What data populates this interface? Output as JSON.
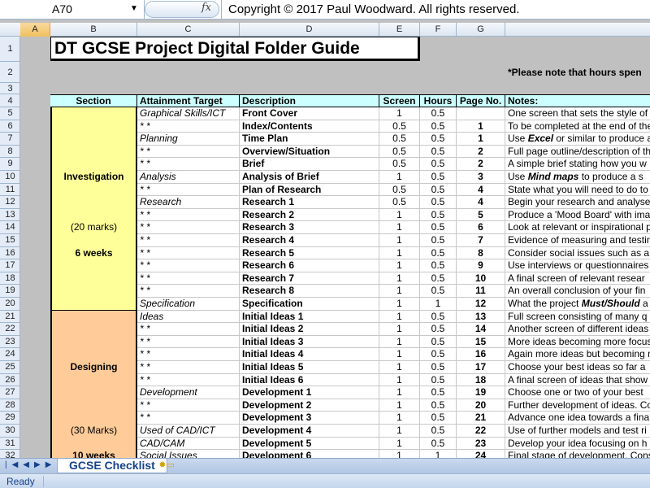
{
  "formula_bar": {
    "name_box": "A70",
    "fx_label": "fx",
    "content": "Copyright © 2017 Paul Woodward. All rights reserved."
  },
  "columns": [
    "A",
    "B",
    "C",
    "D",
    "E",
    "F",
    "G"
  ],
  "selected_column": "A",
  "title": "DT GCSE Project Digital Folder Guide",
  "hours_note": "*Please note that hours spen",
  "headers": {
    "section": "Section",
    "attainment": "Attainment Target",
    "description": "Description",
    "screen": "Screen",
    "hours": "Hours",
    "page": "Page No.",
    "notes": "Notes:"
  },
  "sections": [
    {
      "name": "Investigation",
      "marks": "(20 marks)",
      "weeks": "6 weeks",
      "color": "#ffff99"
    },
    {
      "name": "Designing",
      "marks": "(30 Marks)",
      "weeks": "10 weeks",
      "color": "#ffcc99"
    }
  ],
  "rows": [
    {
      "row": 5,
      "target": "Graphical Skills/ICT",
      "desc": "Front Cover",
      "screen": "1",
      "hours": "0.5",
      "page": "",
      "note": "One screen that sets the style of"
    },
    {
      "row": 6,
      "target": "*               *",
      "desc": "Index/Contents",
      "screen": "0.5",
      "hours": "0.5",
      "page": "1",
      "note": "To be completed at the end of the"
    },
    {
      "row": 7,
      "target": "Planning",
      "desc": "Time Plan",
      "screen": "0.5",
      "hours": "0.5",
      "page": "1",
      "note": "Use Excel  or similar to produce a"
    },
    {
      "row": 8,
      "target": "*       *",
      "desc": "Overview/Situation",
      "screen": "0.5",
      "hours": "0.5",
      "page": "2",
      "note": "Full page outline/description of th"
    },
    {
      "row": 9,
      "target": "*       *",
      "desc": "Brief",
      "screen": "0.5",
      "hours": "0.5",
      "page": "2",
      "note": "A simple brief stating how you w"
    },
    {
      "row": 10,
      "target": "Analysis",
      "desc": "Analysis of Brief",
      "screen": "1",
      "hours": "0.5",
      "page": "3",
      "note": "Use Mind maps  to produce a s"
    },
    {
      "row": 11,
      "target": "*       *",
      "desc": "Plan of Research",
      "screen": "0.5",
      "hours": "0.5",
      "page": "4",
      "note": "State what you will need to do to"
    },
    {
      "row": 12,
      "target": "Research",
      "desc": "Research 1",
      "screen": "0.5",
      "hours": "0.5",
      "page": "4",
      "note": "Begin your research and analyse"
    },
    {
      "row": 13,
      "target": "*       *",
      "desc": "Research 2",
      "screen": "1",
      "hours": "0.5",
      "page": "5",
      "note": "Produce a 'Mood Board' with ima"
    },
    {
      "row": 14,
      "target": "*       *",
      "desc": "Research 3",
      "screen": "1",
      "hours": "0.5",
      "page": "6",
      "note": "Look at relevant or inspirational p"
    },
    {
      "row": 15,
      "target": "*       *",
      "desc": "Research 4",
      "screen": "1",
      "hours": "0.5",
      "page": "7",
      "note": "Evidence of measuring and testin"
    },
    {
      "row": 16,
      "target": "*       *",
      "desc": "Research 5",
      "screen": "1",
      "hours": "0.5",
      "page": "8",
      "note": "Consider social issues such as a"
    },
    {
      "row": 17,
      "target": "*       *",
      "desc": "Research 6",
      "screen": "1",
      "hours": "0.5",
      "page": "9",
      "note": "Use interviews or questionnaires"
    },
    {
      "row": 18,
      "target": "*       *",
      "desc": "Research 7",
      "screen": "1",
      "hours": "0.5",
      "page": "10",
      "note": "A final screen of relevant resear"
    },
    {
      "row": 19,
      "target": "*       *",
      "desc": "Research 8",
      "screen": "1",
      "hours": "0.5",
      "page": "11",
      "note": "An overall conclusion of your fin"
    },
    {
      "row": 20,
      "target": "Specification",
      "desc": "Specification",
      "screen": "1",
      "hours": "1",
      "page": "12",
      "note": "What the project Must/Should  a"
    },
    {
      "row": 21,
      "target": "Ideas",
      "desc": "Initial Ideas 1",
      "screen": "1",
      "hours": "0.5",
      "page": "13",
      "note": "Full screen consisting of many q"
    },
    {
      "row": 22,
      "target": "*   *",
      "desc": "Initial Ideas 2",
      "screen": "1",
      "hours": "0.5",
      "page": "14",
      "note": "Another screen of different ideas"
    },
    {
      "row": 23,
      "target": "*   *",
      "desc": "Initial Ideas 3",
      "screen": "1",
      "hours": "0.5",
      "page": "15",
      "note": "More ideas becoming more focus"
    },
    {
      "row": 24,
      "target": "*   *",
      "desc": "Initial Ideas 4",
      "screen": "1",
      "hours": "0.5",
      "page": "16",
      "note": "Again more ideas but becoming m"
    },
    {
      "row": 25,
      "target": "*   *",
      "desc": "Initial Ideas 5",
      "screen": "1",
      "hours": "0.5",
      "page": "17",
      "note": "Choose your best ideas so far a"
    },
    {
      "row": 26,
      "target": "*   *",
      "desc": "Initial Ideas 6",
      "screen": "1",
      "hours": "0.5",
      "page": "18",
      "note": "A final screen of ideas that show"
    },
    {
      "row": 27,
      "target": "Development",
      "desc": "Development 1",
      "screen": "1",
      "hours": "0.5",
      "page": "19",
      "note": "Choose one or two of your best"
    },
    {
      "row": 28,
      "target": "*            *",
      "desc": "Development 2",
      "screen": "1",
      "hours": "0.5",
      "page": "20",
      "note": "Further development of ideas. Co"
    },
    {
      "row": 29,
      "target": "*            *",
      "desc": "Development 3",
      "screen": "1",
      "hours": "0.5",
      "page": "21",
      "note": "Advance one idea towards a fina"
    },
    {
      "row": 30,
      "target": "Used of CAD/ICT",
      "desc": "Development 4",
      "screen": "1",
      "hours": "0.5",
      "page": "22",
      "note": "Use of further models and test ri"
    },
    {
      "row": 31,
      "target": "CAD/CAM",
      "desc": "Development 5",
      "screen": "1",
      "hours": "0.5",
      "page": "23",
      "note": "Develop your idea focusing on h"
    },
    {
      "row": 32,
      "target": "Social Issues",
      "desc": "Development 6",
      "screen": "1",
      "hours": "1",
      "page": "24",
      "note": "Final stage of development. Cons"
    }
  ],
  "sheet_tabs": {
    "active": "GCSE Checklist",
    "nav_icons": [
      "first-sheet-icon",
      "prev-sheet-icon",
      "next-sheet-icon",
      "last-sheet-icon"
    ],
    "new_sheet_icon": "insert-sheet-icon"
  },
  "status": "Ready"
}
